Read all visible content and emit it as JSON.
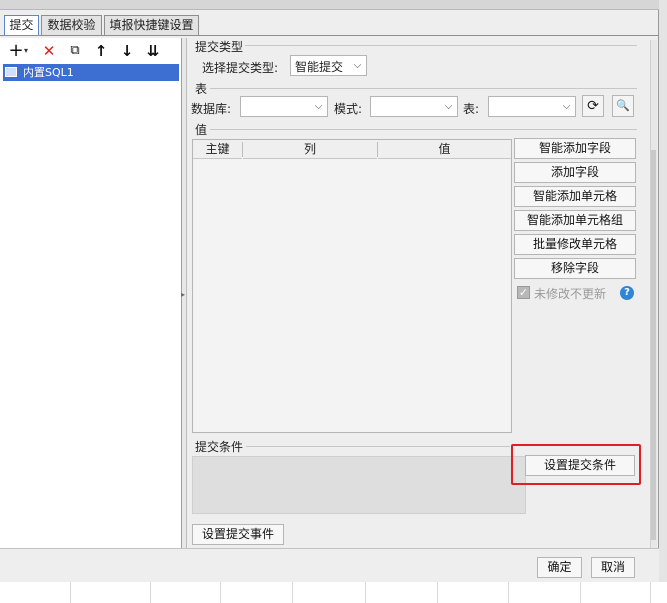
{
  "tabs": [
    {
      "label": "提交",
      "active": true
    },
    {
      "label": "数据校验",
      "active": false
    },
    {
      "label": "填报快捷键设置",
      "active": false
    }
  ],
  "left_toolbar": {
    "icons": [
      "add-icon",
      "delete-icon",
      "copy-icon",
      "move-up-icon",
      "move-down-icon",
      "sort-icon"
    ],
    "glyphs": [
      "+",
      "✕",
      "⧉",
      "↑",
      "↓",
      "⇊"
    ],
    "add_dropdown_glyph": "▾"
  },
  "tree": {
    "items": [
      {
        "label": "内置SQL1",
        "selected": true
      }
    ]
  },
  "submit_type": {
    "section_label": "提交类型",
    "field_label": "选择提交类型:",
    "selected": "智能提交"
  },
  "table_section": {
    "section_label": "表",
    "db_label": "数据库:",
    "schema_label": "模式:",
    "table_label": "表:",
    "db_value": "",
    "schema_value": "",
    "table_value": "",
    "refresh_glyph": "⟳",
    "preview_glyph": "🔍"
  },
  "value_section": {
    "section_label": "值",
    "columns": [
      "主键",
      "列",
      "值"
    ],
    "rows": []
  },
  "side_buttons": [
    "智能添加字段",
    "添加字段",
    "智能添加单元格",
    "智能添加单元格组",
    "批量修改单元格",
    "移除字段"
  ],
  "no_update_unmodified": {
    "label": "未修改不更新",
    "checked": true,
    "enabled": false
  },
  "help_glyph": "?",
  "submit_condition": {
    "section_label": "提交条件",
    "button_label": "设置提交条件"
  },
  "submit_event_button": "设置提交事件",
  "footer": {
    "ok": "确定",
    "cancel": "取消"
  },
  "colors": {
    "selection": "#3d6ed1",
    "highlight_border": "#e02020",
    "help": "#2f86d8"
  }
}
